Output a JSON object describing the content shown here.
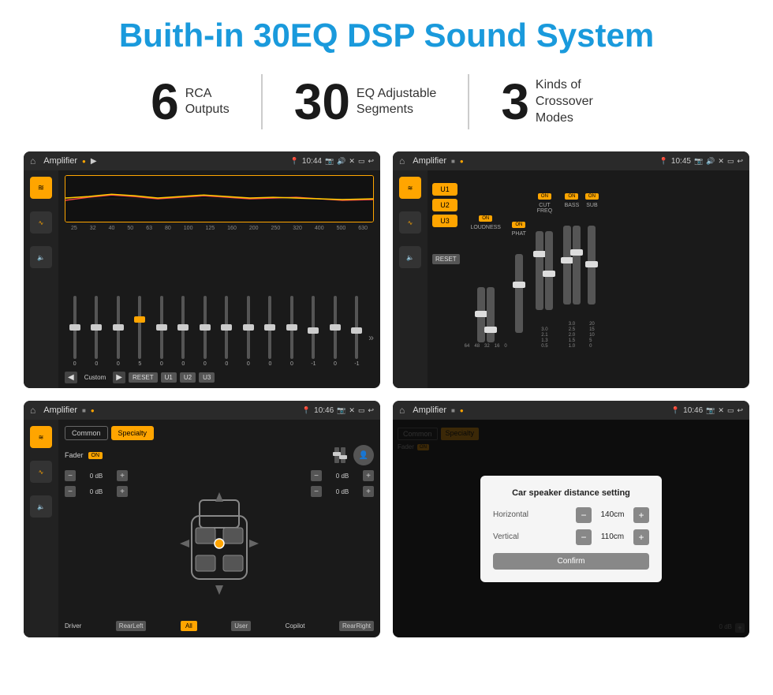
{
  "title": "Buith-in 30EQ DSP Sound System",
  "stats": [
    {
      "number": "6",
      "label": "RCA\nOutputs"
    },
    {
      "number": "30",
      "label": "EQ Adjustable\nSegments"
    },
    {
      "number": "3",
      "label": "Kinds of\nCrossover Modes"
    }
  ],
  "screens": [
    {
      "id": "screen1",
      "title": "Amplifier",
      "time": "10:44",
      "type": "eq",
      "freqs": [
        "25",
        "32",
        "40",
        "50",
        "63",
        "80",
        "100",
        "125",
        "160",
        "200",
        "250",
        "320",
        "400",
        "500",
        "630"
      ],
      "values": [
        "0",
        "0",
        "0",
        "5",
        "0",
        "0",
        "0",
        "0",
        "0",
        "0",
        "0",
        "-1",
        "0",
        "-1"
      ],
      "presets": [
        "Custom",
        "RESET",
        "U1",
        "U2",
        "U3"
      ]
    },
    {
      "id": "screen2",
      "title": "Amplifier",
      "time": "10:45",
      "type": "amp",
      "presets": [
        "U1",
        "U2",
        "U3"
      ],
      "channels": [
        "LOUDNESS",
        "PHAT",
        "CUT FREQ",
        "BASS",
        "SUB"
      ],
      "resetLabel": "RESET"
    },
    {
      "id": "screen3",
      "title": "Amplifier",
      "time": "10:46",
      "type": "fader",
      "tabs": [
        "Common",
        "Specialty"
      ],
      "faderLabel": "Fader",
      "onLabel": "ON",
      "positions": [
        "Driver",
        "RearLeft",
        "All",
        "User",
        "RearRight",
        "Copilot"
      ],
      "dbValues": [
        "0 dB",
        "0 dB",
        "0 dB",
        "0 dB"
      ]
    },
    {
      "id": "screen4",
      "title": "Amplifier",
      "time": "10:46",
      "type": "dialog",
      "dialogTitle": "Car speaker distance setting",
      "horizontal": {
        "label": "Horizontal",
        "value": "140cm"
      },
      "vertical": {
        "label": "Vertical",
        "value": "110cm"
      },
      "confirmLabel": "Confirm",
      "dbRight1": "0 dB",
      "dbRight2": "0 dB"
    }
  ],
  "icons": {
    "home": "⌂",
    "back": "↩",
    "play": "▶",
    "pause": "⏸",
    "prev": "◀",
    "next": "▶",
    "volume": "🔊",
    "location": "📍",
    "camera": "📷",
    "equalizer": "≡",
    "filter": "⟆",
    "speaker": "🔈",
    "user": "👤",
    "minus": "−",
    "plus": "+"
  }
}
